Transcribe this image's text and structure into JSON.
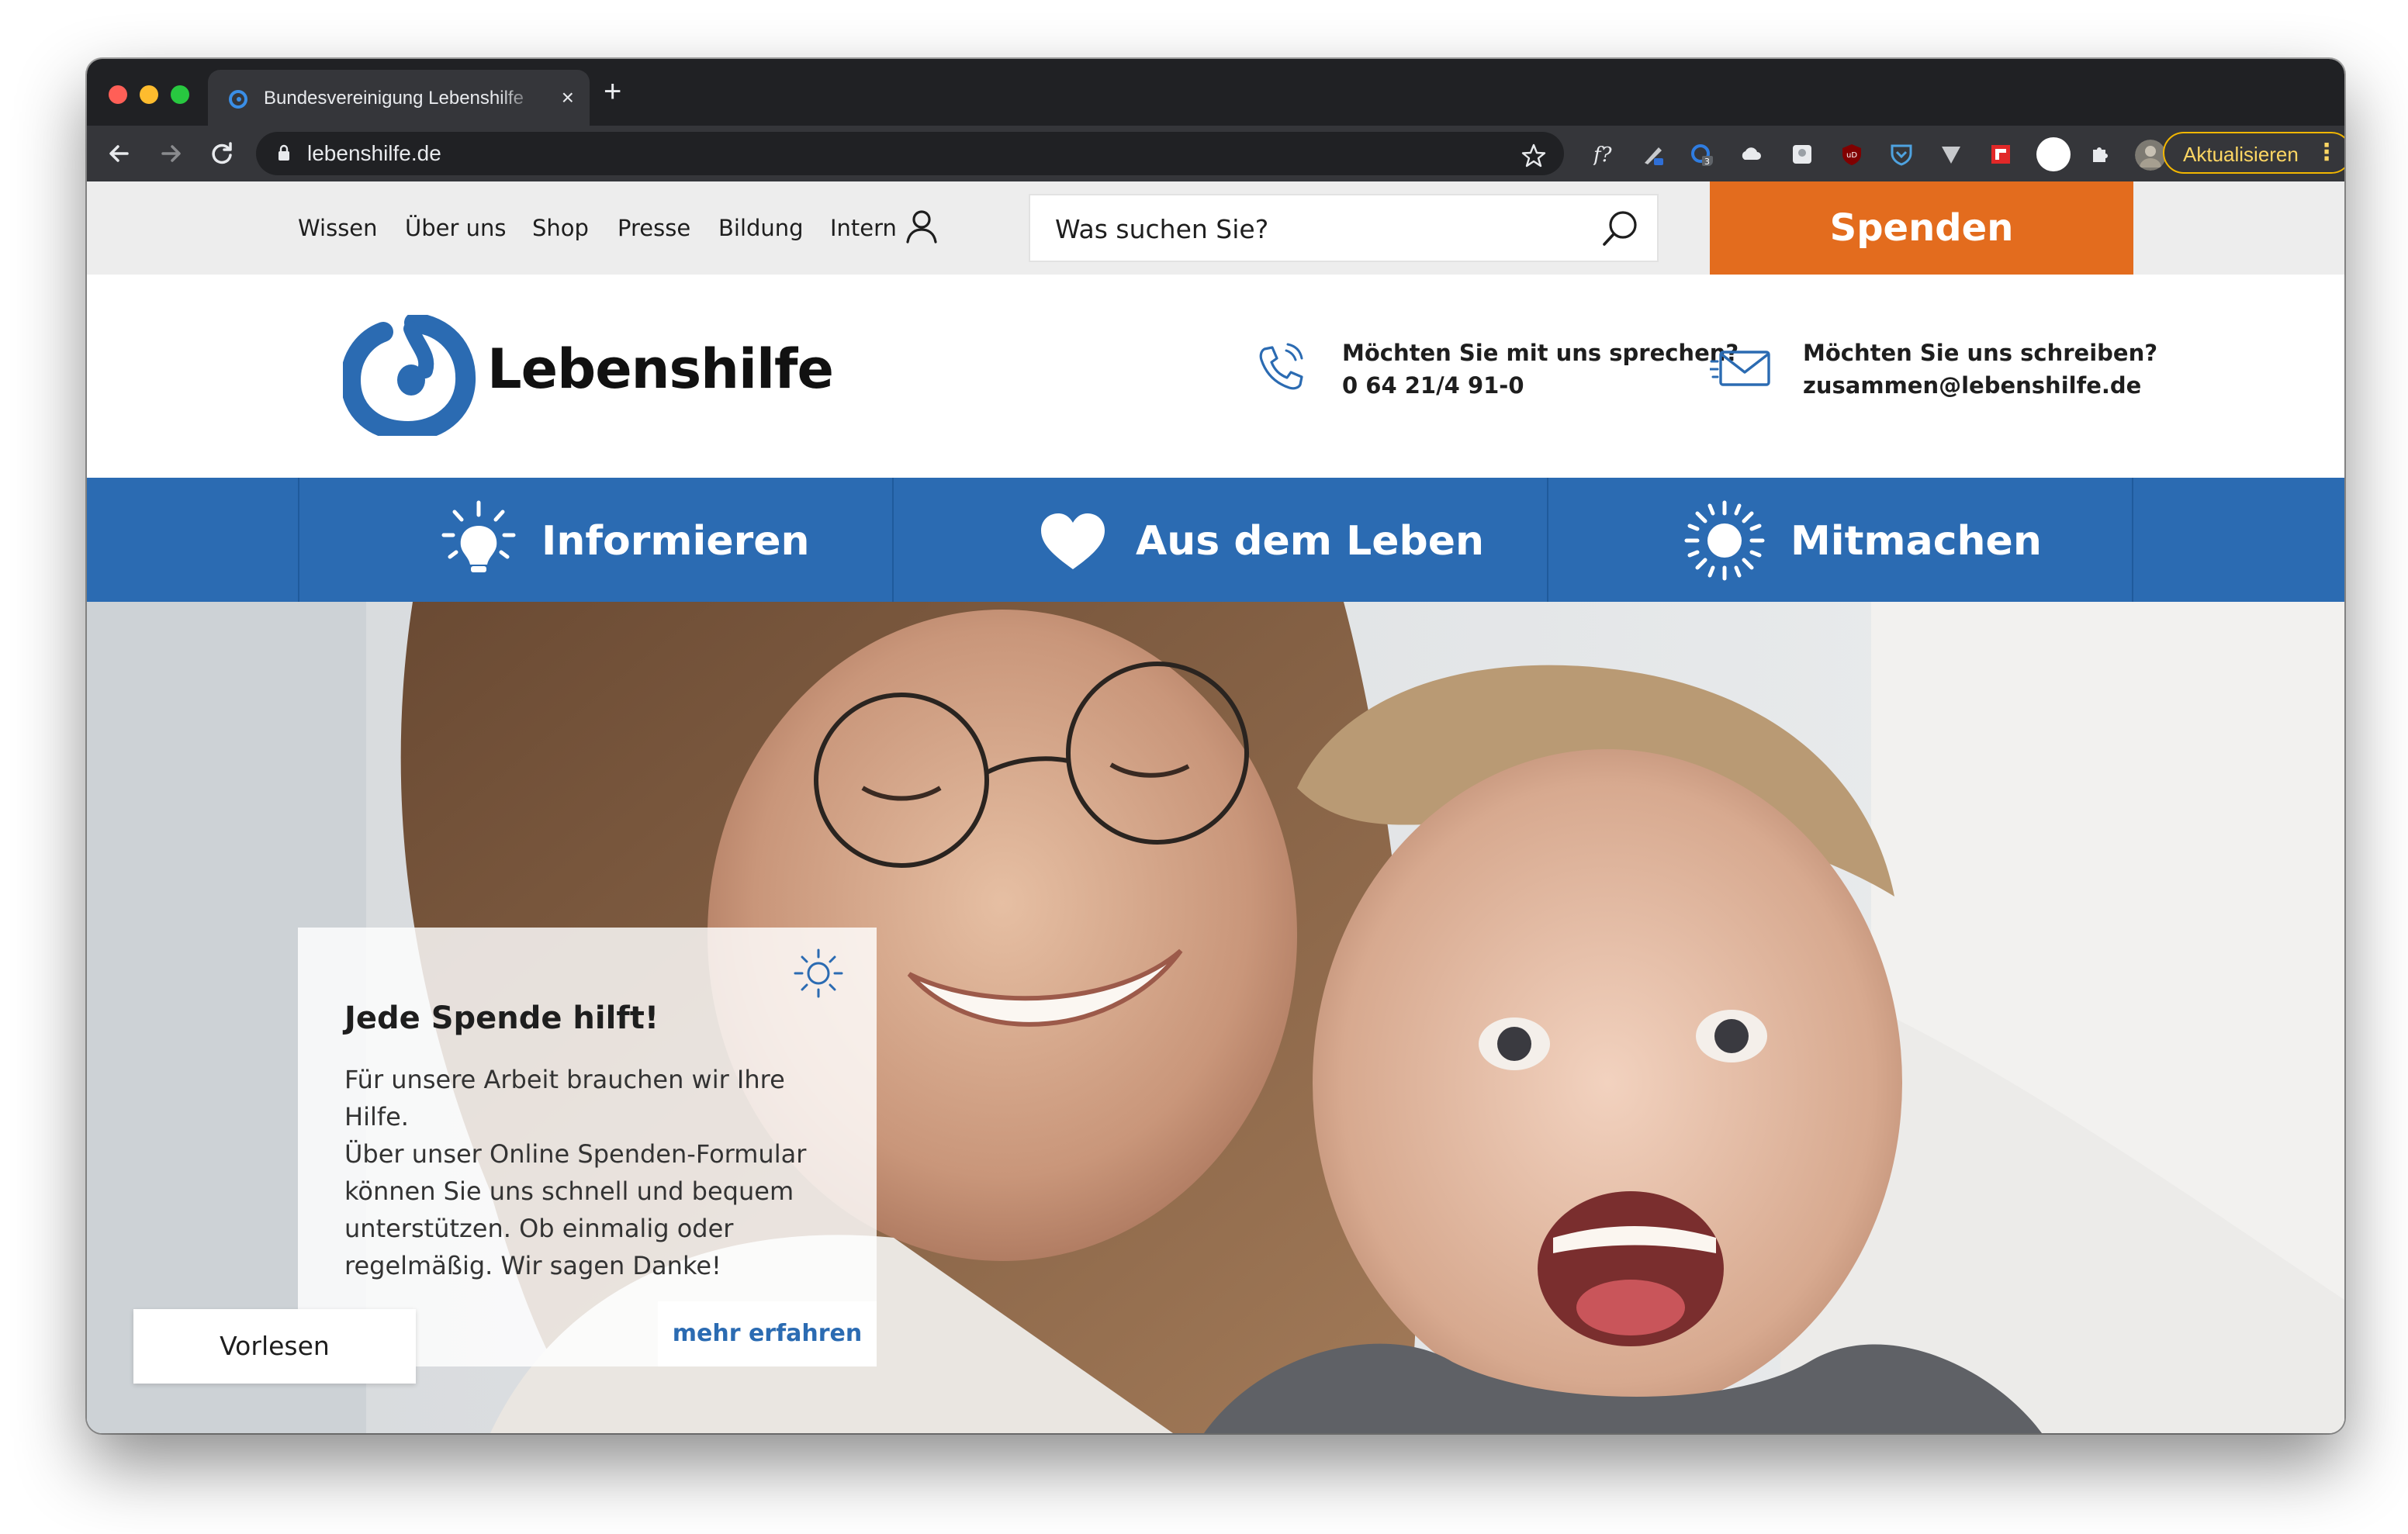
{
  "browser": {
    "tab_title": "Bundesvereinigung Lebenshilfe",
    "tab_close": "×",
    "new_tab": "+",
    "url": "lebenshilfe.de",
    "update_label": "Aktualisieren",
    "menu_glyph": "⋮",
    "extensions": [
      "formula-icon",
      "pen-icon",
      "refresh-badge-icon",
      "cloud-icon",
      "note-icon",
      "ublock-icon",
      "shield-icon",
      "vimium-icon",
      "flipboard-icon",
      "circle-icon",
      "puzzle-icon",
      "profile-avatar"
    ],
    "extension_badge": "3"
  },
  "topbar": {
    "nav": [
      "Wissen",
      "Über uns",
      "Shop",
      "Presse",
      "Bildung",
      "Intern"
    ],
    "search_placeholder": "Was suchen Sie?",
    "donate": "Spenden"
  },
  "header": {
    "brand": "Lebenshilfe",
    "phone_question": "Möchten Sie mit uns sprechen?",
    "phone_number": "0 64 21/4 91-0",
    "mail_question": "Möchten Sie uns schreiben?",
    "mail_address": "zusammen@lebenshilfe.de"
  },
  "mainnav": [
    {
      "label": "Informieren",
      "icon": "lightbulb-icon"
    },
    {
      "label": "Aus dem Leben",
      "icon": "heart-icon"
    },
    {
      "label": "Mitmachen",
      "icon": "sun-icon"
    }
  ],
  "hero": {
    "card_title": "Jede Spende hilft!",
    "card_lines": [
      "Für unsere Arbeit brauchen wir Ihre Hilfe.",
      "Über unser Online Spenden-Formular",
      "können Sie uns schnell und bequem",
      "unterstützen. Ob einmalig oder",
      "regelmäßig. Wir sagen Danke!"
    ],
    "more": "mehr erfahren",
    "read_aloud": "Vorlesen"
  },
  "colors": {
    "brand_blue": "#2b6bb2",
    "donate_orange": "#e36c1e",
    "update_yellow": "#f2b600"
  }
}
